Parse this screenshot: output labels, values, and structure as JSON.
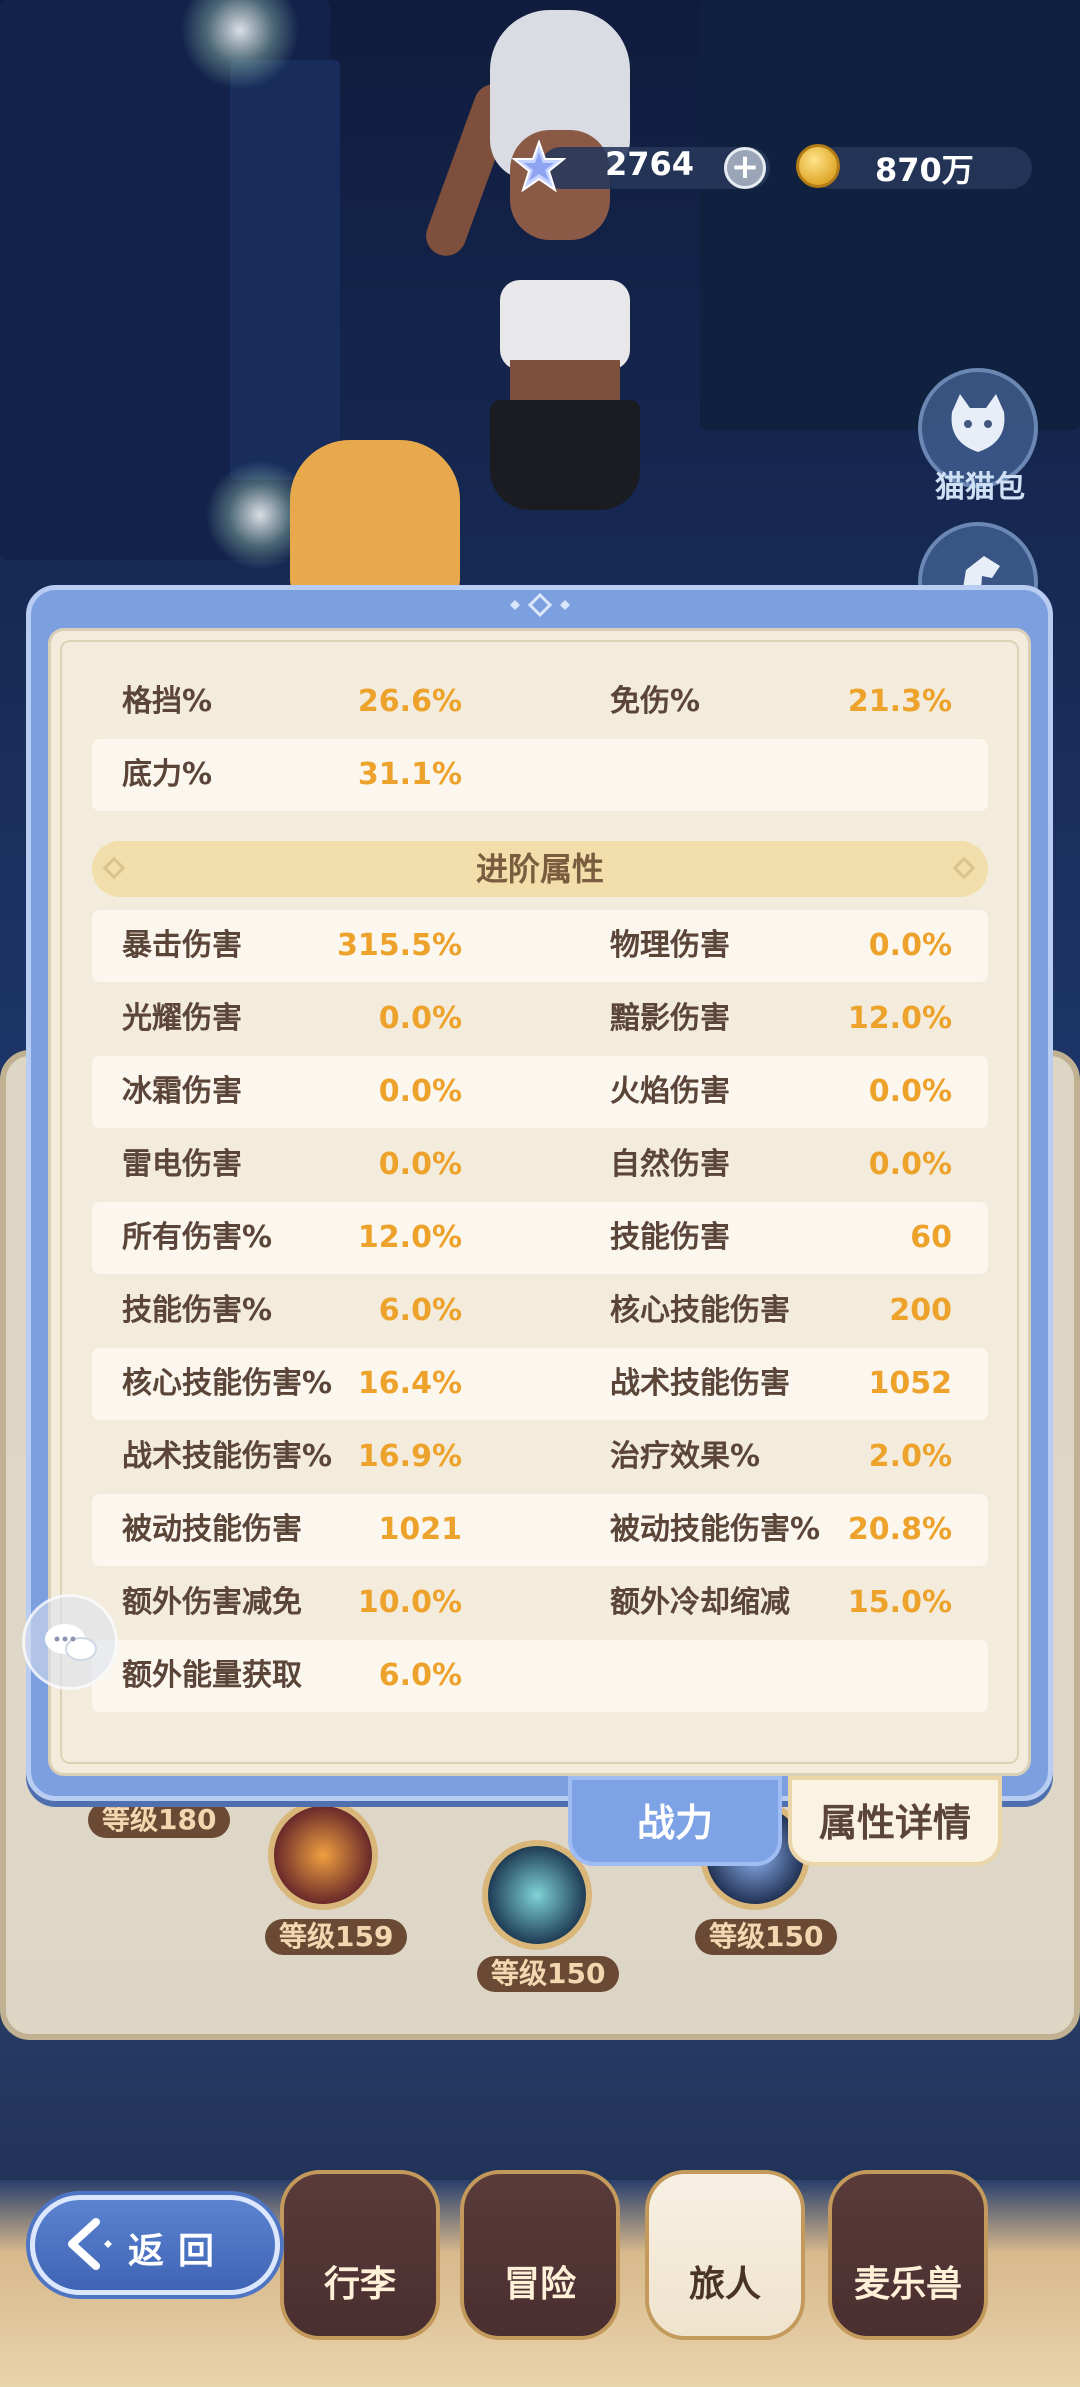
{
  "currency": {
    "gems": "2764",
    "gold": "870万"
  },
  "side_menu": {
    "cat_bag_label": "猫猫包"
  },
  "stats": {
    "basic_rows": [
      {
        "l1": "格挡%",
        "v1": "26.6%",
        "l2": "免伤%",
        "v2": "21.3%"
      },
      {
        "l1": "底力%",
        "v1": "31.1%",
        "l2": "",
        "v2": ""
      }
    ],
    "advanced_title": "进阶属性",
    "advanced_rows": [
      {
        "l1": "暴击伤害",
        "v1": "315.5%",
        "l2": "物理伤害",
        "v2": "0.0%"
      },
      {
        "l1": "光耀伤害",
        "v1": "0.0%",
        "l2": "黯影伤害",
        "v2": "12.0%"
      },
      {
        "l1": "冰霜伤害",
        "v1": "0.0%",
        "l2": "火焰伤害",
        "v2": "0.0%"
      },
      {
        "l1": "雷电伤害",
        "v1": "0.0%",
        "l2": "自然伤害",
        "v2": "0.0%"
      },
      {
        "l1": "所有伤害%",
        "v1": "12.0%",
        "l2": "技能伤害",
        "v2": "60"
      },
      {
        "l1": "技能伤害%",
        "v1": "6.0%",
        "l2": "核心技能伤害",
        "v2": "200"
      },
      {
        "l1": "核心技能伤害%",
        "v1": "16.4%",
        "l2": "战术技能伤害",
        "v2": "1052"
      },
      {
        "l1": "战术技能伤害%",
        "v1": "16.9%",
        "l2": "治疗效果%",
        "v2": "2.0%"
      },
      {
        "l1": "被动技能伤害",
        "v1": "1021",
        "l2": "被动技能伤害%",
        "v2": "20.8%"
      },
      {
        "l1": "额外伤害减免",
        "v1": "10.0%",
        "l2": "额外冷却缩减",
        "v2": "15.0%"
      },
      {
        "l1": "额外能量获取",
        "v1": "6.0%",
        "l2": "",
        "v2": ""
      }
    ]
  },
  "tabs": {
    "power": "战力",
    "detail": "属性详情"
  },
  "under_panel": {
    "levels": [
      "等级180",
      "等级159",
      "等级150",
      "等级150"
    ]
  },
  "nav": {
    "back": "返回",
    "items": [
      "行李",
      "冒险",
      "旅人",
      "麦乐兽"
    ],
    "active_index": 2
  },
  "colors": {
    "value_orange": "#eda22b",
    "label_brown": "#5b4538",
    "panel_blue": "#7c9fe0"
  }
}
